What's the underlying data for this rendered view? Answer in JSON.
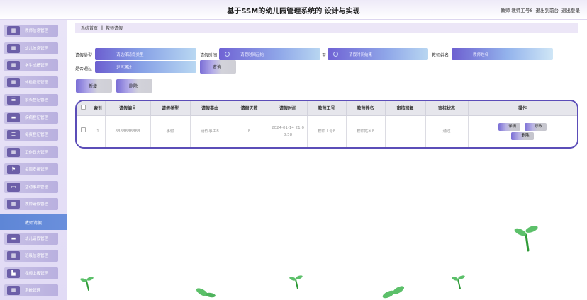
{
  "header": {
    "title": "基于SSM的幼儿园管理系统的 设计与实现",
    "user_label": "教师 教师工号8",
    "goto_front": "退出到前台",
    "logout": "退出登录"
  },
  "sidebar": {
    "items": [
      {
        "label": "教师信息管理",
        "icon": "grid-icon"
      },
      {
        "label": "幼儿信息管理",
        "icon": "grid-icon"
      },
      {
        "label": "学生成绩管理",
        "icon": "grid-icon"
      },
      {
        "label": "体检登记管理",
        "icon": "grid-icon"
      },
      {
        "label": "家长登记管理",
        "icon": "list-icon"
      },
      {
        "label": "疾病登记管理",
        "icon": "chat-icon"
      },
      {
        "label": "每费登记管理",
        "icon": "list-icon"
      },
      {
        "label": "工作日志管理",
        "icon": "grid-icon"
      },
      {
        "label": "每周安排管理",
        "icon": "flag-icon"
      },
      {
        "label": "活动事项管理",
        "icon": "monitor-icon"
      },
      {
        "label": "教师请假管理",
        "icon": "grid-icon"
      }
    ],
    "active": "教师请假",
    "items_after": [
      {
        "label": "幼儿请假管理",
        "icon": "chat-icon"
      },
      {
        "label": "班级信息管理",
        "icon": "grid-icon"
      },
      {
        "label": "视频上报管理",
        "icon": "chart-icon"
      },
      {
        "label": "系统管理",
        "icon": "grid-icon"
      }
    ]
  },
  "breadcrumb": {
    "home": "系统首页",
    "separator": "ǁ",
    "current": "教师请假"
  },
  "search": {
    "leave_type_label": "请假类型",
    "leave_type_placeholder": "请选择请假类型",
    "leave_time_label": "请假时间",
    "start_placeholder": "请假时间起始",
    "to_label": "至",
    "end_placeholder": "请假时间结束",
    "teacher_name_label": "教师姓名",
    "teacher_name_placeholder": "教师姓名",
    "pass_label": "是否通过",
    "pass_placeholder": "是否通过",
    "query_button": "查询"
  },
  "toolbar": {
    "add_button": "新增",
    "delete_button": "删除"
  },
  "table": {
    "headers": [
      "索引",
      "请假编号",
      "请假类型",
      "请假事由",
      "请假天数",
      "请假时间",
      "教师工号",
      "教师姓名",
      "审核回复",
      "审核状态",
      "操作"
    ],
    "rows": [
      {
        "index": "1",
        "leave_no": "8888888888",
        "leave_type": "事假",
        "reason": "请假事由8",
        "days": "8",
        "time_line1": "2024-01-14 21:0",
        "time_line2": "8:58",
        "teacher_no": "教师工号8",
        "teacher_name": "教师姓名8",
        "reply": "",
        "status": "通过",
        "actions": {
          "detail": "详情",
          "edit": "修改",
          "delete": "删除"
        }
      }
    ]
  },
  "colors": {
    "accent": "#5b4db8",
    "sidebar_active": "#5e86d6",
    "sprout": "#2f9a37"
  }
}
